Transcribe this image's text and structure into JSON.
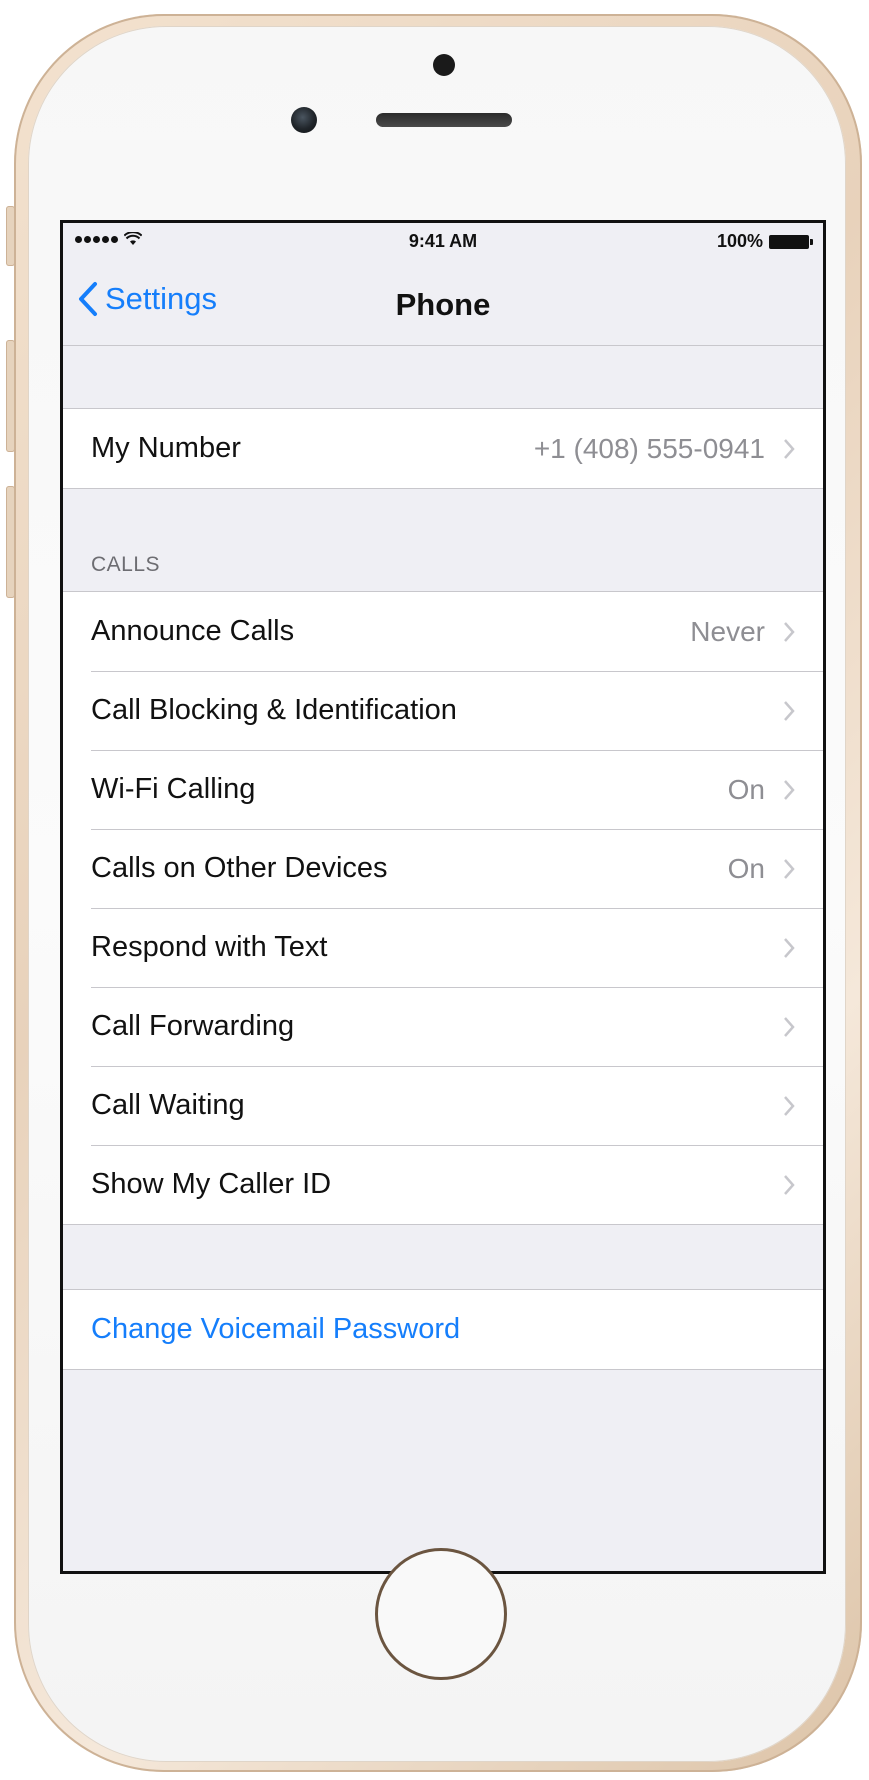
{
  "status_bar": {
    "time": "9:41 AM",
    "battery": "100%"
  },
  "nav": {
    "back_label": "Settings",
    "title": "Phone"
  },
  "my_number": {
    "label": "My Number",
    "value": "+1 (408) 555-0941"
  },
  "calls_section": {
    "header": "CALLS",
    "items": [
      {
        "label": "Announce Calls",
        "value": "Never"
      },
      {
        "label": "Call Blocking & Identification",
        "value": ""
      },
      {
        "label": "Wi-Fi Calling",
        "value": "On"
      },
      {
        "label": "Calls on Other Devices",
        "value": "On"
      },
      {
        "label": "Respond with Text",
        "value": ""
      },
      {
        "label": "Call Forwarding",
        "value": ""
      },
      {
        "label": "Call Waiting",
        "value": ""
      },
      {
        "label": "Show My Caller ID",
        "value": ""
      }
    ]
  },
  "voicemail": {
    "label": "Change Voicemail Password"
  },
  "colors": {
    "accent": "#157efb",
    "background": "#efeff4",
    "secondary_text": "#8e8e93",
    "phone_gold": "#e8d2bb"
  }
}
